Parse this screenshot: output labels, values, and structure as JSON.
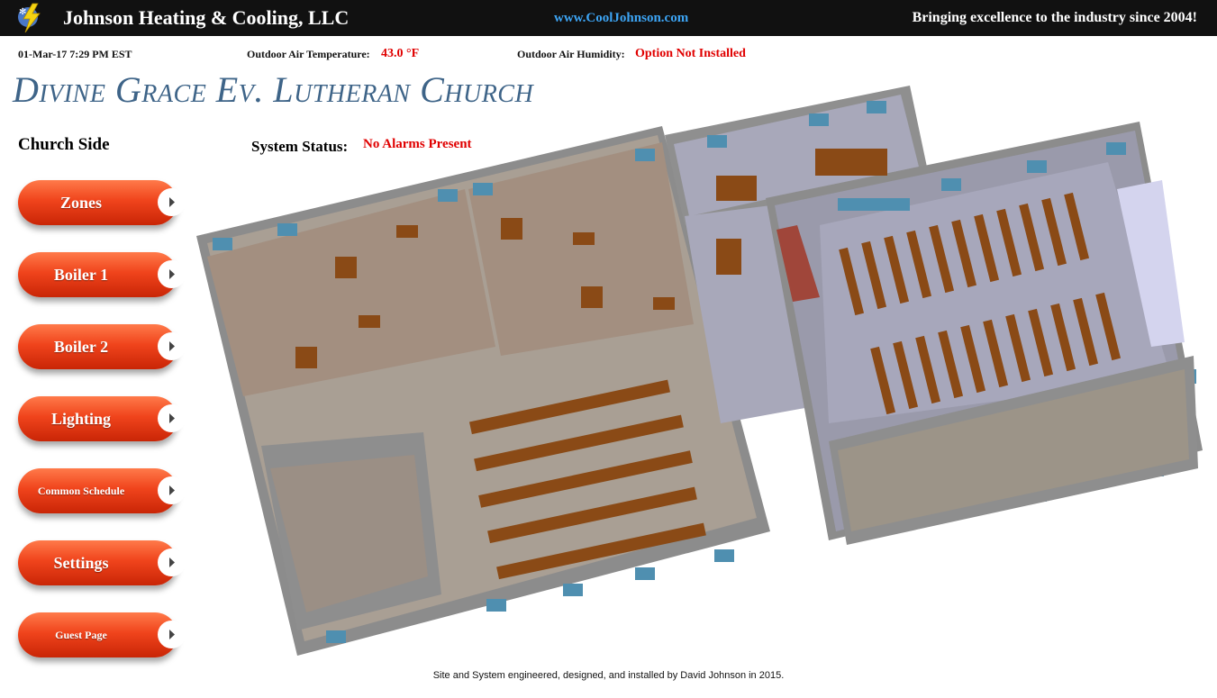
{
  "header": {
    "company": "Johnson Heating & Cooling, LLC",
    "website": "www.CoolJohnson.com",
    "tagline": "Bringing excellence to the industry since 2004!",
    "logo_icon": "lightning-bolt-snowflake-icon"
  },
  "info_bar": {
    "datetime": "01-Mar-17 7:29 PM EST",
    "temp_label": "Outdoor Air Temperature:",
    "temp_value": "43.0 °F",
    "humidity_label": "Outdoor Air Humidity:",
    "humidity_value": "Option Not Installed"
  },
  "church_title": "Divine Grace Ev. Lutheran Church",
  "side_label": "Church Side",
  "system_status": {
    "label": "System Status:",
    "value": "No Alarms Present"
  },
  "nav": {
    "items": [
      {
        "label": "Zones"
      },
      {
        "label": "Boiler 1"
      },
      {
        "label": "Boiler 2"
      },
      {
        "label": "Lighting"
      },
      {
        "label": "Common Schedule"
      },
      {
        "label": "Settings"
      },
      {
        "label": "Guest Page"
      }
    ]
  },
  "footer": "Site and System engineered, designed, and installed by David Johnson in 2015.",
  "colors": {
    "accent_red": "#e00000",
    "button": "#f0441c",
    "link_blue": "#3da5f5",
    "title_blue": "#3e6488"
  }
}
